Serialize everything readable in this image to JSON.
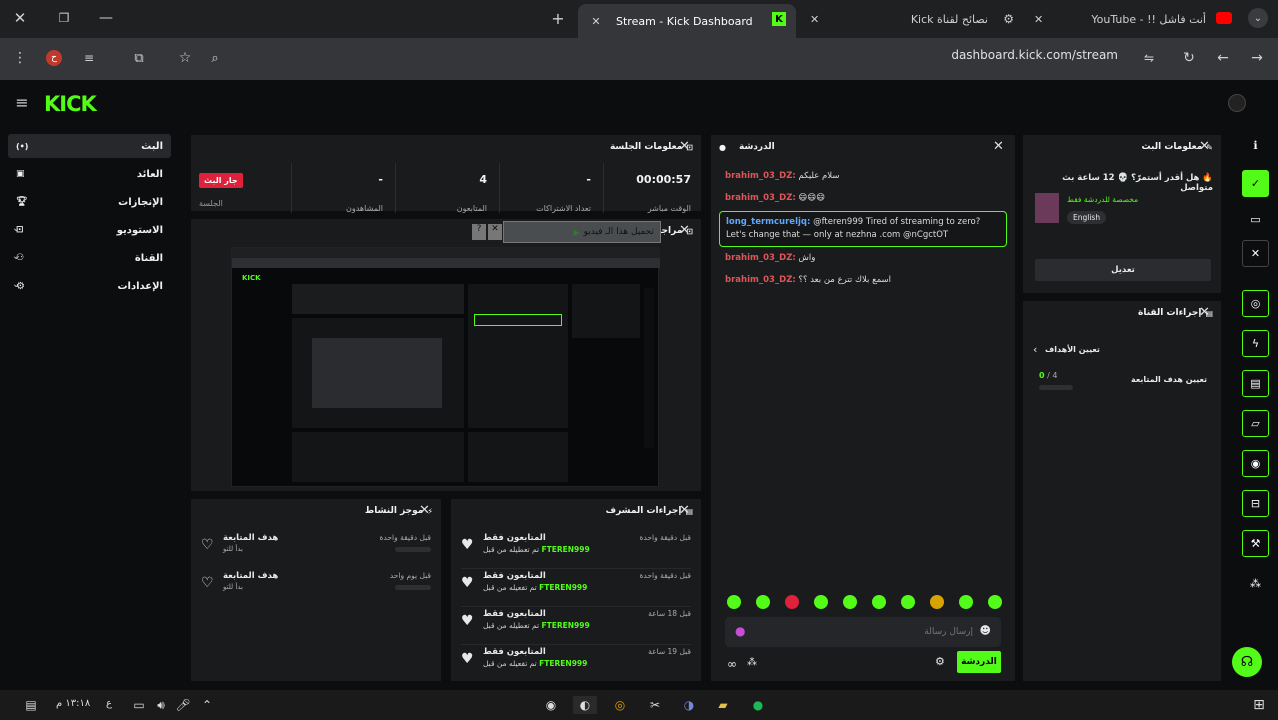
{
  "browser": {
    "tabs": [
      {
        "label": "Stream - Kick Dashboard"
      },
      {
        "label": "نصائح لقناة Kick"
      },
      {
        "label": "أنت فاشل !! - YouTube"
      }
    ],
    "url": "dashboard.kick.com/stream"
  },
  "app": {
    "logo": "KICK"
  },
  "nav": {
    "items": [
      {
        "label": "البث"
      },
      {
        "label": "العائد"
      },
      {
        "label": "الإنجازات"
      },
      {
        "label": "الاستوديو"
      },
      {
        "label": "القناة"
      },
      {
        "label": "الإعدادات"
      }
    ]
  },
  "session": {
    "title": "معلومات الجلسة",
    "stats": [
      {
        "value": "00:00:57",
        "label": "الوقت مباشر"
      },
      {
        "value": "-",
        "label": "تعداد الاشتراكات"
      },
      {
        "value": "4",
        "label": "المتابعون"
      },
      {
        "value": "-",
        "label": "المشاهدون"
      }
    ],
    "live_badge": "جار البث",
    "live_sub": "الجلسة"
  },
  "preview": {
    "title": "مراجعة البث",
    "download_label": "تحميل هذا الـ فيديو"
  },
  "activity": {
    "title": "موجز النشاط",
    "rows": [
      {
        "title": "هدف المتابعة",
        "sub": "بدأ للتو",
        "time": "قبل دقيقة واحدة"
      },
      {
        "title": "هدف المتابعة",
        "sub": "بدأ للتو",
        "time": "قبل يوم واحد"
      }
    ]
  },
  "mod": {
    "title": "إجراءات المشرف",
    "rows": [
      {
        "title": "المتابعون فقط",
        "sub": "تم تعطيله من قبل",
        "user": "FTEREN999",
        "time": "قبل دقيقة واحدة"
      },
      {
        "title": "المتابعون فقط",
        "sub": "تم تفعيله من قبل",
        "user": "FTEREN999",
        "time": "قبل دقيقة واحدة"
      },
      {
        "title": "المتابعون فقط",
        "sub": "تم تعطيله من قبل",
        "user": "FTEREN999",
        "time": "قبل 18 ساعة"
      },
      {
        "title": "المتابعون فقط",
        "sub": "تم تفعيله من قبل",
        "user": "FTEREN999",
        "time": "قبل 19 ساعة"
      }
    ]
  },
  "chat": {
    "title": "الدردشة",
    "messages": [
      {
        "user": "",
        "text": "سلام عليكم"
      },
      {
        "user": "brahim_03_DZ:",
        "text": "😄😄😄"
      },
      {
        "user": "long_termcureljq:",
        "text": "@fteren999 Tired of streaming to zero? Let's change that — only at nezhna .com @nCgctOT"
      },
      {
        "user": "brahim_03_DZ:",
        "text": "واش"
      },
      {
        "user": "brahim_03_DZ:",
        "text": "اسمع بلاك تترع من بعد ؟؟"
      }
    ],
    "first_user": "brahim_03_DZ:",
    "input_placeholder": "إرسال رسالة",
    "send_label": "الدردشة"
  },
  "streaminfo": {
    "title": "معلومات البث",
    "stream_title": "🔥 هل أقدر أستمرّ؟ 💀 12 ساعة بث متواصل",
    "category": "مخصصة للدردشة فقط",
    "tag": "English",
    "edit_label": "تعديل"
  },
  "channel": {
    "title": "إجراءات القناة",
    "goal_header": "تعيين الأهداف",
    "goal_label": "تعيين هدف المتابعة",
    "goal_value": "0",
    "goal_target": "/ 4"
  },
  "taskbar": {
    "time": "١٣:١٨ م",
    "lang": "ع"
  },
  "colors": {
    "accent": "#53fc18",
    "danger": "#e0213b"
  }
}
